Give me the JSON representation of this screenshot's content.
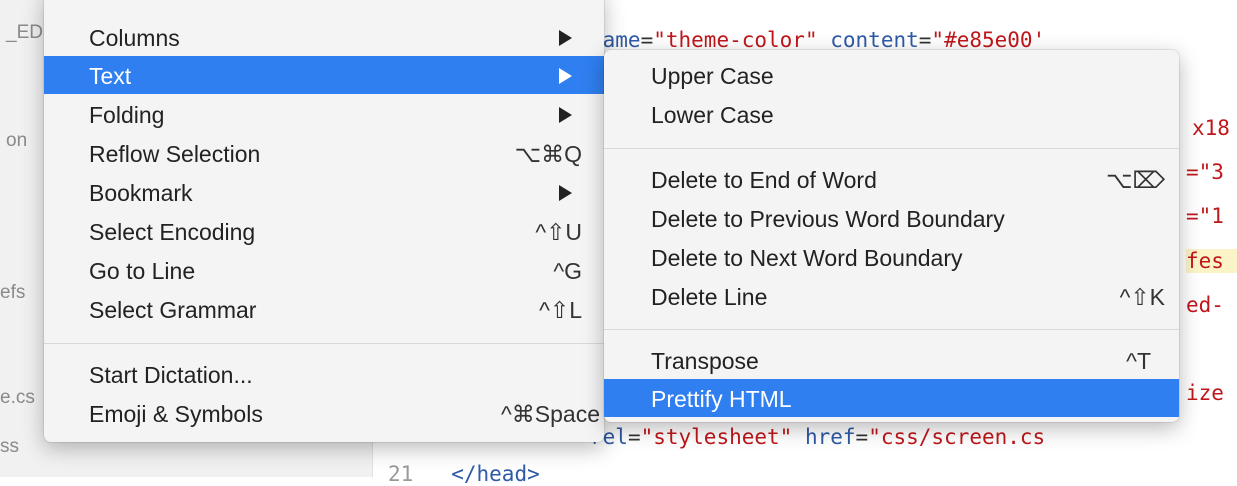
{
  "sidebar": {
    "fragments": [
      "_ED",
      "on",
      "efs",
      "e.cs",
      "ss"
    ]
  },
  "editor": {
    "lines": [
      {
        "attr": "name",
        "eq": "=",
        "str": "\"theme-color\"",
        "attr2": " content",
        "eq2": "=",
        "str2": "\"#e85e00'"
      },
      {
        "frag": "x18"
      },
      {
        "frag": "=\"3"
      },
      {
        "frag": "=\"1"
      },
      {
        "frag": "fes"
      },
      {
        "frag": "ed-"
      },
      {
        "frag": "ize"
      },
      {
        "attr": "rel",
        "eq": "=",
        "str": "\"stylesheet\"",
        "attr2": " href",
        "eq2": "=",
        "str2": "\"css/screen.cs"
      },
      {
        "num": "21",
        "tag": "</head>"
      }
    ]
  },
  "main_menu": {
    "items": [
      {
        "label": "Columns",
        "shortcut": "",
        "submenu": true
      },
      {
        "label": "Text",
        "shortcut": "",
        "submenu": true
      },
      {
        "label": "Folding",
        "shortcut": "",
        "submenu": true
      },
      {
        "label": "Reflow Selection",
        "shortcut": "⌥⌘Q",
        "submenu": false
      },
      {
        "label": "Bookmark",
        "shortcut": "",
        "submenu": true
      },
      {
        "label": "Select Encoding",
        "shortcut": "^⇧U",
        "submenu": false
      },
      {
        "label": "Go to Line",
        "shortcut": "^G",
        "submenu": false
      },
      {
        "label": "Select Grammar",
        "shortcut": "^⇧L",
        "submenu": false
      },
      {
        "label": "Start Dictation...",
        "shortcut": "",
        "submenu": false
      },
      {
        "label": "Emoji & Symbols",
        "shortcut": "^⌘Space",
        "submenu": false
      }
    ],
    "active_index": 1
  },
  "sub_menu": {
    "items": [
      {
        "label": "Upper Case",
        "shortcut": ""
      },
      {
        "label": "Lower Case",
        "shortcut": ""
      },
      {
        "label": "Delete to End of Word",
        "shortcut": "⌥⌦"
      },
      {
        "label": "Delete to Previous Word Boundary",
        "shortcut": ""
      },
      {
        "label": "Delete to Next Word Boundary",
        "shortcut": ""
      },
      {
        "label": "Delete Line",
        "shortcut": "^⇧K"
      },
      {
        "label": "Transpose",
        "shortcut": "^T"
      },
      {
        "label": "Prettify HTML",
        "shortcut": ""
      }
    ],
    "active_index": 7
  },
  "colors": {
    "highlight": "#2f7ff0",
    "menu_bg": "#f4f4f4",
    "code_string": "#c0171a",
    "code_attr": "#2e5aa7"
  }
}
